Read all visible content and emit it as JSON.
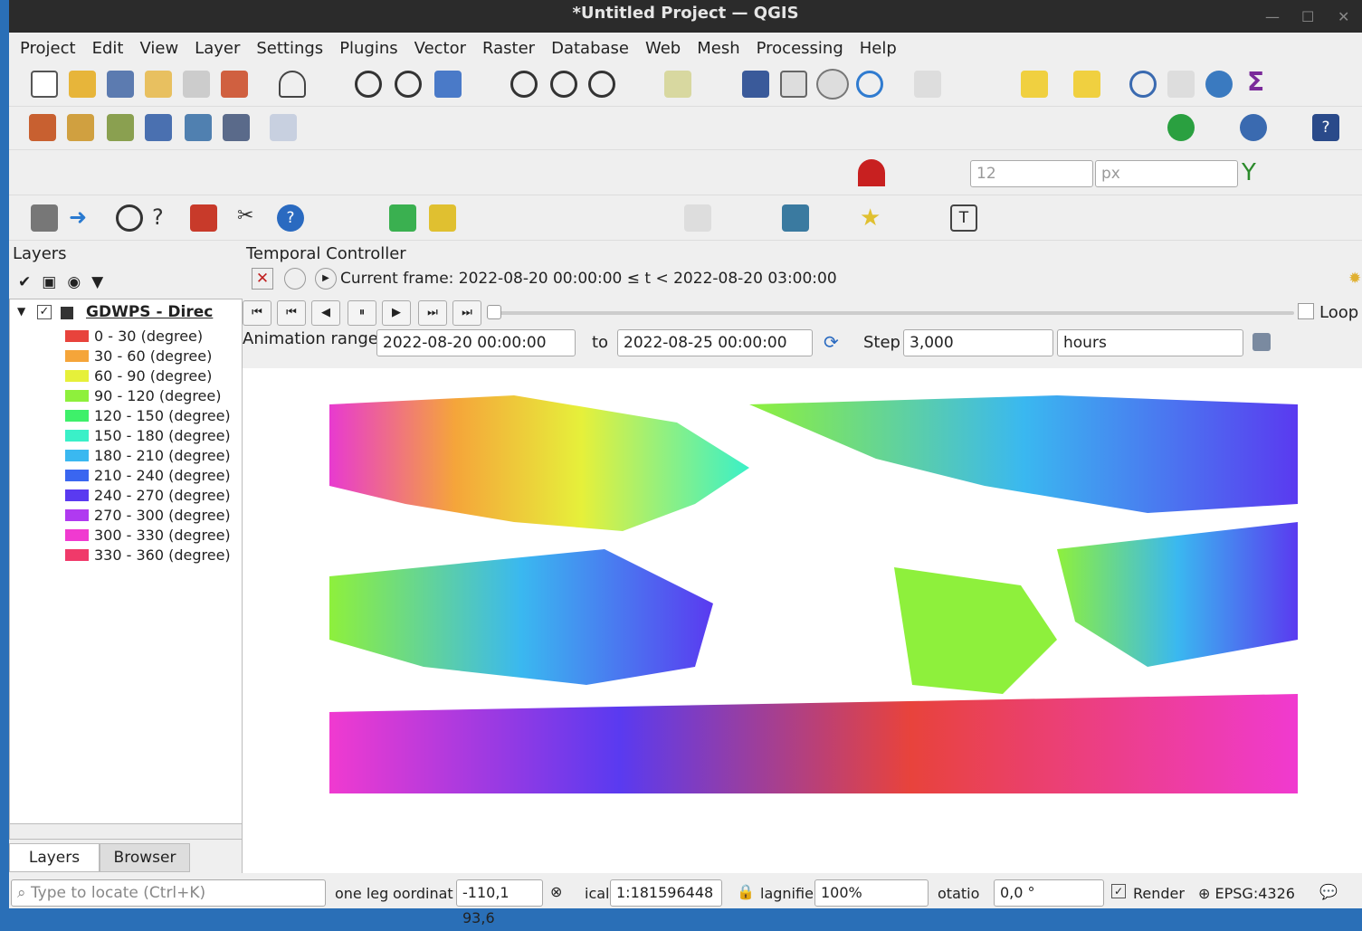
{
  "title": "*Untitled Project — QGIS",
  "menu": [
    "Project",
    "Edit",
    "View",
    "Layer",
    "Settings",
    "Plugins",
    "Vector",
    "Raster",
    "Database",
    "Web",
    "Mesh",
    "Processing",
    "Help"
  ],
  "layers": {
    "title": "Layers",
    "layer_name": "GDWPS - Direc",
    "legend": [
      {
        "label": "0 - 30 (degree)",
        "color": "#e8433c"
      },
      {
        "label": "30 - 60 (degree)",
        "color": "#f5a53a"
      },
      {
        "label": "60 - 90 (degree)",
        "color": "#e6f03a"
      },
      {
        "label": "90 - 120 (degree)",
        "color": "#8ef03c"
      },
      {
        "label": "120 - 150 (degree)",
        "color": "#3ef06a"
      },
      {
        "label": "150 - 180 (degree)",
        "color": "#3af0c8"
      },
      {
        "label": "180 - 210 (degree)",
        "color": "#3ab8f0"
      },
      {
        "label": "210 - 240 (degree)",
        "color": "#3a66f0"
      },
      {
        "label": "240 - 270 (degree)",
        "color": "#5a3af0"
      },
      {
        "label": "270 - 300 (degree)",
        "color": "#b03af0"
      },
      {
        "label": "300 - 330 (degree)",
        "color": "#f03ad0"
      },
      {
        "label": "330 - 360 (degree)",
        "color": "#f03a6a"
      }
    ],
    "tabs": [
      "Layers",
      "Browser"
    ]
  },
  "temporal": {
    "title": "Temporal Controller",
    "frame": "Current frame: 2022-08-20 00:00:00 ≤ t < 2022-08-20 03:00:00",
    "range_label": "Animation range",
    "range_from": "2022-08-20 00:00:00",
    "to_label": "to",
    "range_to": "2022-08-25 00:00:00",
    "step_label": "Step",
    "step_value": "3,000",
    "unit": "hours",
    "loop": "Loop"
  },
  "toolbar": {
    "spin_value": "12",
    "unit": "px"
  },
  "status": {
    "locate_placeholder": "Type to locate (Ctrl+K)",
    "legend_trunc": "one leg",
    "coord_label": "oordinat",
    "coord": "-110,1 93,6",
    "scale_label": "ical",
    "scale": "1:181596448",
    "magnifier_label": "lagnifie",
    "magnifier": "100%",
    "rotation_label": "otatio",
    "rotation": "0,0 °",
    "render": "Render",
    "crs": "EPSG:4326"
  }
}
